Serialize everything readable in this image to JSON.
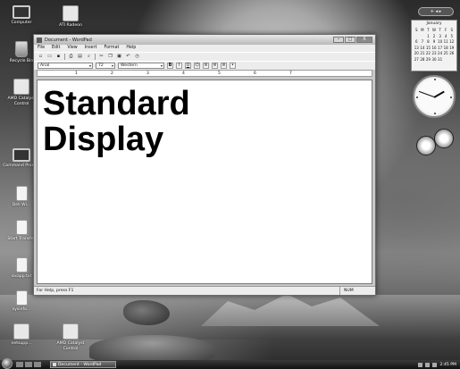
{
  "desktop": {
    "icons": [
      {
        "label": "Computer"
      },
      {
        "label": "Recycle Bin"
      },
      {
        "label": "ATI Radeon"
      },
      {
        "label": "Command Prompt"
      },
      {
        "label": "Dell Wi..."
      },
      {
        "label": "Start Transfer"
      },
      {
        "label": "sixapp.txt"
      },
      {
        "label": "sysinfo..."
      },
      {
        "label": "netsupp..."
      },
      {
        "label": "AMD Catalyst Control"
      }
    ]
  },
  "window": {
    "title": "Document - WordPad",
    "minimize_label": "–",
    "maximize_label": "□",
    "close_label": "X",
    "menu": [
      "File",
      "Edit",
      "View",
      "Insert",
      "Format",
      "Help"
    ],
    "toolbar_icons": [
      "new-icon",
      "open-icon",
      "save-icon",
      "print-icon",
      "print-preview-icon",
      "find-icon",
      "cut-icon",
      "copy-icon",
      "paste-icon",
      "undo-icon",
      "date-time-icon"
    ],
    "font_name": "Arial",
    "font_size": "72",
    "script": "Western",
    "format_buttons": [
      "B",
      "I",
      "U",
      "⌬",
      "≡",
      "≡",
      "≡",
      "•"
    ],
    "ruler_labels": [
      "1",
      "2",
      "3",
      "4",
      "5",
      "6",
      "7"
    ],
    "document_lines": [
      "Standard",
      "Display"
    ],
    "status_help": "For Help, press F1",
    "status_num": "NUM"
  },
  "calendar": {
    "month": "January",
    "days_of_week": [
      "S",
      "M",
      "T",
      "W",
      "T",
      "F",
      "S"
    ],
    "weeks": [
      [
        "",
        "",
        "1",
        "2",
        "3",
        "4",
        "5"
      ],
      [
        "6",
        "7",
        "8",
        "9",
        "10",
        "11",
        "12"
      ],
      [
        "13",
        "14",
        "15",
        "16",
        "17",
        "18",
        "19"
      ],
      [
        "20",
        "21",
        "22",
        "23",
        "24",
        "25",
        "26"
      ],
      [
        "27",
        "28",
        "29",
        "30",
        "31",
        "",
        ""
      ]
    ]
  },
  "taskbar": {
    "task_label": "Document - WordPad",
    "clock": "2:45 PM"
  },
  "colors": {
    "window_frame": "#c8c8c8",
    "document_bg": "#ffffff",
    "taskbar": "#1a1a1a"
  }
}
